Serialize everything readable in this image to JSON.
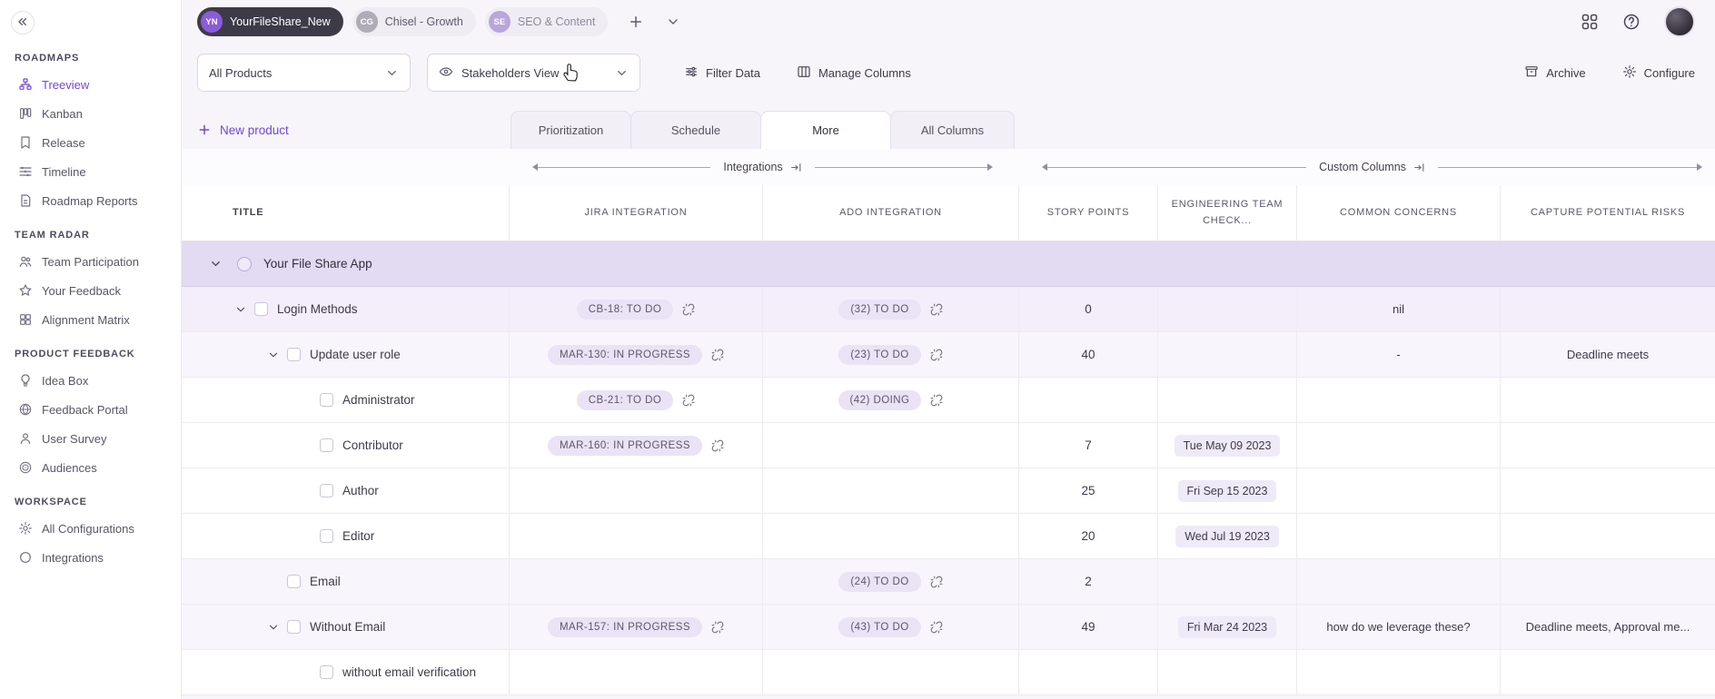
{
  "sidebar": {
    "sections": [
      {
        "title": "ROADMAPS",
        "items": [
          {
            "label": "Treeview",
            "icon": "treeview-icon",
            "active": true
          },
          {
            "label": "Kanban",
            "icon": "kanban-icon"
          },
          {
            "label": "Release",
            "icon": "release-icon"
          },
          {
            "label": "Timeline",
            "icon": "timeline-icon"
          },
          {
            "label": "Roadmap Reports",
            "icon": "reports-icon"
          }
        ]
      },
      {
        "title": "TEAM RADAR",
        "items": [
          {
            "label": "Team Participation",
            "icon": "people-icon"
          },
          {
            "label": "Your Feedback",
            "icon": "star-icon"
          },
          {
            "label": "Alignment Matrix",
            "icon": "grid-icon"
          }
        ]
      },
      {
        "title": "PRODUCT FEEDBACK",
        "items": [
          {
            "label": "Idea Box",
            "icon": "lightbulb-icon"
          },
          {
            "label": "Feedback Portal",
            "icon": "globe-icon"
          },
          {
            "label": "User Survey",
            "icon": "person-icon"
          },
          {
            "label": "Audiences",
            "icon": "target-icon"
          }
        ]
      },
      {
        "title": "WORKSPACE",
        "items": [
          {
            "label": "All Configurations",
            "icon": "gear-icon"
          },
          {
            "label": "Integrations",
            "icon": "circle-icon"
          }
        ]
      }
    ]
  },
  "topbar": {
    "workspaces": [
      {
        "initials": "YN",
        "label": "YourFileShare_New",
        "active": true
      },
      {
        "initials": "CG",
        "label": "Chisel - Growth",
        "active": false
      },
      {
        "initials": "SE",
        "label": "SEO & Content",
        "active": false
      }
    ]
  },
  "toolbar": {
    "product_filter": "All Products",
    "view_selector": "Stakeholders View",
    "filter_button": "Filter Data",
    "manage_columns_button": "Manage Columns",
    "archive_button": "Archive",
    "configure_button": "Configure"
  },
  "actions_row": {
    "new_product": "New product",
    "tabs": [
      {
        "label": "Prioritization",
        "active": false
      },
      {
        "label": "Schedule",
        "active": false
      },
      {
        "label": "More",
        "active": true
      },
      {
        "label": "All Columns",
        "active": false
      }
    ]
  },
  "column_groups": {
    "integrations": "Integrations",
    "custom_columns": "Custom Columns"
  },
  "table": {
    "columns": [
      "TITLE",
      "JIRA INTEGRATION",
      "ADO INTEGRATION",
      "STORY POINTS",
      "ENGINEERING TEAM CHECK...",
      "COMMON CONCERNS",
      "CAPTURE POTENTIAL RISKS"
    ],
    "group_row": {
      "title": "Your File Share App"
    },
    "rows": [
      {
        "title": "Login Methods",
        "level": 1,
        "chevron": true,
        "jira": "CB-18: TO DO",
        "ado": "(32) TO DO",
        "sp": "0",
        "eng": "",
        "concerns": "nil",
        "risks": "",
        "tint": 1
      },
      {
        "title": "Update user role",
        "level": 2,
        "chevron": true,
        "jira": "MAR-130: IN PROGRESS",
        "ado": "(23) TO DO",
        "sp": "40",
        "eng": "",
        "concerns": "-",
        "risks": "Deadline meets",
        "tint": 2
      },
      {
        "title": "Administrator",
        "level": 3,
        "chevron": false,
        "jira": "CB-21: TO DO",
        "ado": "(42) DOING",
        "sp": "",
        "eng": "",
        "concerns": "",
        "risks": "",
        "tint": 0
      },
      {
        "title": "Contributor",
        "level": 3,
        "chevron": false,
        "jira": "MAR-160: IN PROGRESS",
        "ado": "",
        "sp": "7",
        "eng": "Tue May 09 2023",
        "concerns": "",
        "risks": "",
        "tint": 0
      },
      {
        "title": "Author",
        "level": 3,
        "chevron": false,
        "jira": "",
        "ado": "",
        "sp": "25",
        "eng": "Fri Sep 15 2023",
        "concerns": "",
        "risks": "",
        "tint": 0
      },
      {
        "title": "Editor",
        "level": 3,
        "chevron": false,
        "jira": "",
        "ado": "",
        "sp": "20",
        "eng": "Wed Jul 19 2023",
        "concerns": "",
        "risks": "",
        "tint": 0
      },
      {
        "title": "Email",
        "level": 2,
        "chevron": false,
        "jira": "",
        "ado": "(24) TO DO",
        "sp": "2",
        "eng": "",
        "concerns": "",
        "risks": "",
        "tint": 2
      },
      {
        "title": "Without Email",
        "level": 2,
        "chevron": true,
        "jira": "MAR-157: IN PROGRESS",
        "ado": "(43) TO DO",
        "sp": "49",
        "eng": "Fri Mar 24 2023",
        "concerns": "how do we leverage these?",
        "risks": "Deadline meets, Approval me...",
        "tint": 2
      },
      {
        "title": "without email verification",
        "level": 3,
        "chevron": false,
        "jira": "",
        "ado": "",
        "sp": "",
        "eng": "",
        "concerns": "",
        "risks": "",
        "tint": 0
      }
    ]
  },
  "colors": {
    "accent": "#7146D6",
    "group_row_bg": "#E2DBF1",
    "tint_row_bg": "#F3EEF9",
    "pill_bg": "#EAE3F6",
    "date_pill_bg": "#EFEAF8",
    "active_chip_bg": "#3E3B48"
  }
}
